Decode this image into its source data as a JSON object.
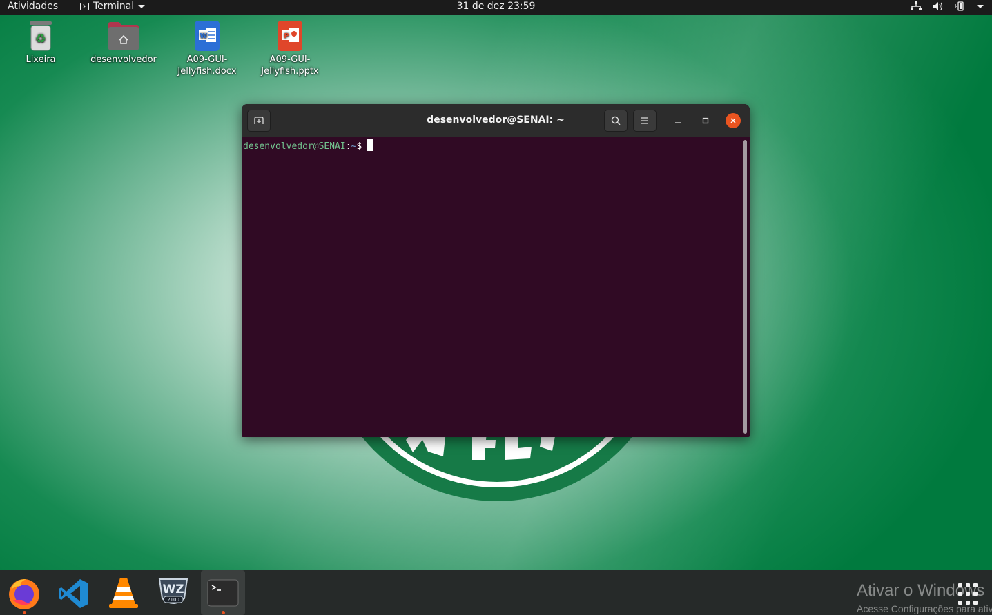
{
  "topbar": {
    "activities": "Atividades",
    "app_menu_label": "Terminal",
    "clock": "31 de dez  23:59",
    "status_icons": [
      "network-icon",
      "volume-icon",
      "battery-icon",
      "system-menu-caret-icon"
    ]
  },
  "desktop_icons": [
    {
      "label": "Lixeira",
      "icon": "trash-icon"
    },
    {
      "label": "desenvolvedor",
      "icon": "home-folder-icon"
    },
    {
      "label_line1": "A09-GUI-",
      "label_line2": "Jellyfish.docx",
      "icon": "word-document-icon"
    },
    {
      "label_line1": "A09-GUI-",
      "label_line2": "Jellyfish.pptx",
      "icon": "powerpoint-document-icon"
    }
  ],
  "terminal": {
    "title": "desenvolvedor@SENAI: ~",
    "prompt_user": "desenvolvedor@SENAI",
    "prompt_colon": ":",
    "prompt_path": "~",
    "prompt_symbol": "$",
    "colors": {
      "background": "#300a24",
      "user": "#73c48f",
      "path": "#729fcf"
    }
  },
  "dock": {
    "apps": [
      "firefox-icon",
      "vscode-icon",
      "vlc-icon",
      "wz2100-icon",
      "terminal-icon"
    ],
    "active_app": "terminal-icon",
    "show_apps": "show-applications-icon"
  },
  "watermark": {
    "line1": "Ativar o Windows",
    "line2": "Acesse Configurações para ativar o Windows."
  },
  "colors": {
    "topbar": "#1b1b1b",
    "dock": "#262a29",
    "ubuntu_orange": "#e95420",
    "wallpaper_green": "#007a3e"
  }
}
